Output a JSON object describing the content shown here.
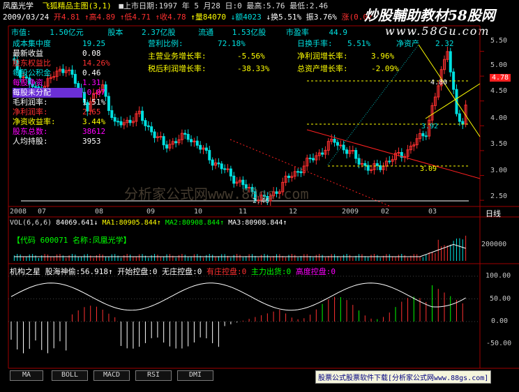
{
  "window": {
    "stock_name": "凤凰光学",
    "formula": "飞狐精品主图(3,1)",
    "listing": "■上市日期:1997 年 5 月28 日:0 最高:5.76 最低:2.46",
    "logo": "炒股輔助教材58股网",
    "logo_url": "www.58Gu.com"
  },
  "quote": {
    "date": "2009/03/24",
    "open": "开4.81",
    "high": "↑高4.89",
    "low": "↑低4.71",
    "close": "↑收4.78",
    "volume": "↑量84070",
    "amount": "↓额4023",
    "turnover": "↓换5.51%",
    "amplitude": "振3.76%",
    "change": "涨(0.02)"
  },
  "fin_top": [
    {
      "label": "市值:",
      "value": "1.50亿元"
    },
    {
      "label": "股本",
      "value": "2.37亿股"
    },
    {
      "label": "流通",
      "value": "1.53亿股"
    },
    {
      "label": "市盈率",
      "value": "44.9"
    }
  ],
  "fin_left": [
    {
      "label": "成本集中度",
      "value": "19.25"
    },
    {
      "label": "最新收益",
      "value": "0.08"
    },
    {
      "label": "股东权益比",
      "value": "14.26%"
    },
    {
      "label": "每股公积金",
      "value": "0.46"
    },
    {
      "label": "每股净资",
      "value": "1.31"
    },
    {
      "label": "每股未分配",
      "value": "-0.07"
    },
    {
      "label": "毛利润率:",
      "value": "1.51%"
    },
    {
      "label": "净利润率:",
      "value": "2.65"
    },
    {
      "label": "净资收益率:",
      "value": "3.44%"
    },
    {
      "label": "股东总数:",
      "value": "38612"
    },
    {
      "label": "人均持股:",
      "value": "3953"
    }
  ],
  "fin_mid": [
    {
      "label": "营利比例:",
      "value": "72.18%"
    },
    {
      "label": "主营业务增长率:",
      "value": "-5.56%"
    },
    {
      "label": "税后利润增长率:",
      "value": "-38.33%"
    }
  ],
  "fin_right": [
    {
      "label": "日换手率:",
      "value": "5.51%"
    },
    {
      "label": "净资产",
      "value": "2.32"
    },
    {
      "label": "净利润增长率:",
      "value": "3.96%"
    },
    {
      "label": "总资产增长率:",
      "value": "-2.09%"
    }
  ],
  "price_axis": [
    "5.50",
    "5.00",
    "4.50",
    "4.00",
    "3.50",
    "3.00",
    "2.50"
  ],
  "price_tag": "4.78",
  "price_annotations": {
    "low": "2.46",
    "mid": "3.09",
    "mid2": "3.92",
    "top": "4.80"
  },
  "watermark": "分析家公式网www.88gs.com",
  "date_axis": [
    "2008",
    "07",
    "08",
    "09",
    "10",
    "11",
    "12",
    "2009",
    "02",
    "03"
  ],
  "period_label": "日线",
  "vol_header": {
    "label": "VOL(6,6,6)",
    "v1": "84069.641↓",
    "ma1": "MA1:80905.844↑",
    "ma2": "MA2:80908.844↑",
    "ma3": "MA3:80908.844↑"
  },
  "vol_info": "【代码 600071 名称:凤凰光学】",
  "vol_axis": "200000",
  "ind_header": {
    "title": "机构之星",
    "s1": "股海神偷:56.918↑",
    "s2": "开始控盘:0",
    "s3": "无庄控盘:0",
    "s4": "有庄控盘:0",
    "s5": "主力出货:0",
    "s6": "高度控盘:0"
  },
  "ind_axis": [
    "100.00",
    "50.00",
    "0.00",
    "-50.00"
  ],
  "tabs": [
    "MA",
    "BOLL",
    "MACD",
    "RSI",
    "DMI"
  ],
  "footer_ad": "股票公式股票软件下载[分析家公式网www.88gs.com]",
  "colors": {
    "up": "#ff3030",
    "down": "#00e0e0",
    "yellow": "#ffff00",
    "white": "#ffffff",
    "magenta": "#ff00ff",
    "green": "#00ff00",
    "grid": "#8b0000",
    "panel_line": "#a00000"
  },
  "chart_data": {
    "type": "candlestick",
    "ylim": [
      2.46,
      5.76
    ],
    "bars_note": "generated from price path"
  }
}
